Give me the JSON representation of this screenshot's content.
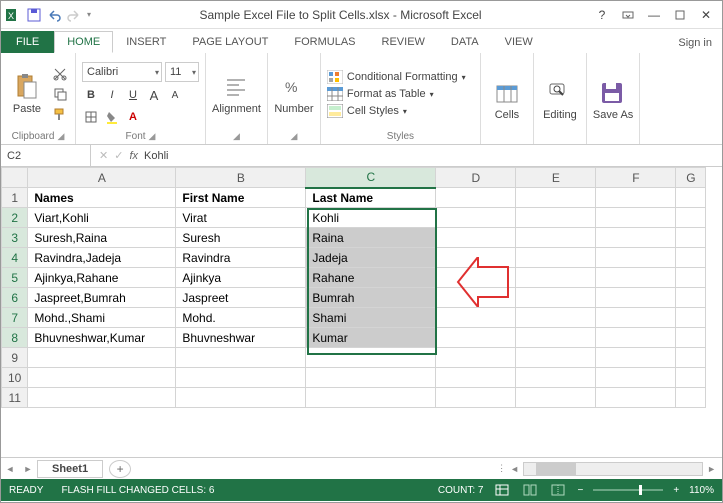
{
  "title": "Sample Excel File to Split Cells.xlsx - Microsoft Excel",
  "signin": "Sign in",
  "tabs": {
    "file": "FILE",
    "home": "HOME",
    "insert": "INSERT",
    "page": "PAGE LAYOUT",
    "formulas": "FORMULAS",
    "review": "REVIEW",
    "data": "DATA",
    "view": "VIEW"
  },
  "ribbon": {
    "clipboard": {
      "paste": "Paste",
      "label": "Clipboard"
    },
    "font": {
      "name": "Calibri",
      "size": "11",
      "label": "Font"
    },
    "alignment": {
      "label": "Alignment"
    },
    "number": {
      "label": "Number"
    },
    "styles": {
      "cf": "Conditional Formatting",
      "fat": "Format as Table",
      "cs": "Cell Styles",
      "label": "Styles"
    },
    "cells": {
      "label": "Cells"
    },
    "editing": {
      "label": "Editing"
    },
    "saveas": {
      "label": "Save As"
    }
  },
  "namebox": "C2",
  "formula": "Kohli",
  "cols": [
    "A",
    "B",
    "C",
    "D",
    "E",
    "F",
    "G"
  ],
  "headers": {
    "a": "Names",
    "b": "First Name",
    "c": "Last Name"
  },
  "rows": [
    {
      "a": "Viart,Kohli",
      "b": "Virat",
      "c": "Kohli"
    },
    {
      "a": "Suresh,Raina",
      "b": "Suresh",
      "c": "Raina"
    },
    {
      "a": "Ravindra,Jadeja",
      "b": "Ravindra",
      "c": "Jadeja"
    },
    {
      "a": "Ajinkya,Rahane",
      "b": "Ajinkya",
      "c": "Rahane"
    },
    {
      "a": "Jaspreet,Bumrah",
      "b": "Jaspreet",
      "c": "Bumrah"
    },
    {
      "a": "Mohd.,Shami",
      "b": "Mohd.",
      "c": "Shami"
    },
    {
      "a": "Bhuvneshwar,Kumar",
      "b": "Bhuvneshwar",
      "c": "Kumar"
    }
  ],
  "sheet": "Sheet1",
  "status": {
    "ready": "READY",
    "ff": "FLASH FILL CHANGED CELLS: 6",
    "count": "COUNT: 7",
    "zoom": "110%"
  }
}
